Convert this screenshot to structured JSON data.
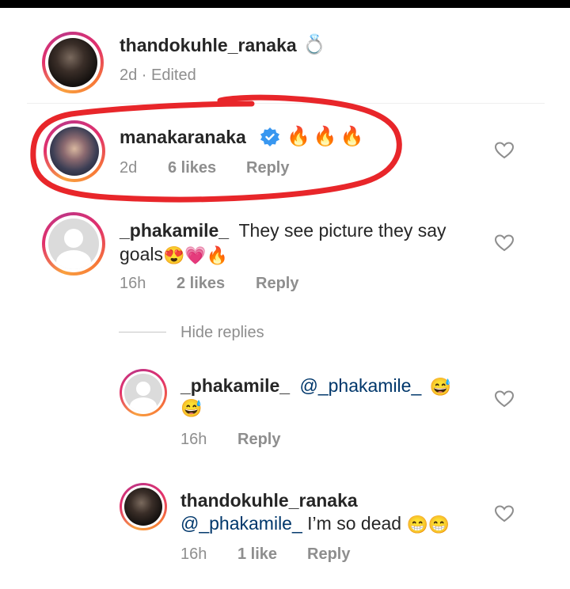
{
  "caption": {
    "username": "thandokuhle_ranaka",
    "ring_emoji": "💍",
    "meta": "2d · Edited"
  },
  "comments": [
    {
      "username": "manakaranaka",
      "verified": true,
      "text_emoji": "🔥🔥🔥",
      "time": "2d",
      "likes": "6 likes",
      "reply": "Reply"
    },
    {
      "username": "_phakamile_",
      "text_line1": "They see picture they say",
      "text_line2": "goals",
      "emoji": "😍💗🔥",
      "time": "16h",
      "likes": "2 likes",
      "reply": "Reply"
    }
  ],
  "hide_replies": "Hide replies",
  "replies": [
    {
      "username": "_phakamile_",
      "mention": "@_phakamile_",
      "emoji": "😅",
      "emoji2": "😅",
      "time": "16h",
      "reply": "Reply"
    },
    {
      "username": "thandokuhle_ranaka",
      "mention": "@_phakamile_",
      "text": " I’m so dead ",
      "emoji": "😁😁",
      "time": "16h",
      "likes": "1 like",
      "reply": "Reply"
    }
  ],
  "colors": {
    "annotation_circle": "#e8262a",
    "verified_badge": "#3897f0",
    "mention": "#00376b",
    "meta_text": "#8e8e8e"
  }
}
